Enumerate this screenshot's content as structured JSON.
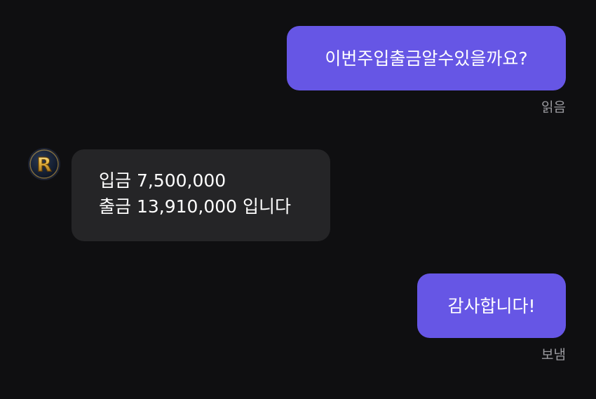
{
  "messages": [
    {
      "direction": "outgoing",
      "text": "이번주입출금알수있을까요?",
      "status": "읽음"
    },
    {
      "direction": "incoming",
      "lines": [
        "입금 7,500,000",
        "출금 13,910,000 입니다"
      ],
      "avatar": "gold-r-logo"
    },
    {
      "direction": "outgoing",
      "text": "감사합니다!",
      "status": "보냄"
    }
  ],
  "avatar": {
    "logo_text": "R"
  },
  "colors": {
    "background": "#0f0f11",
    "outgoing_bubble": "#6656e5",
    "incoming_bubble": "#252527",
    "status_text": "#9b9ba0"
  }
}
